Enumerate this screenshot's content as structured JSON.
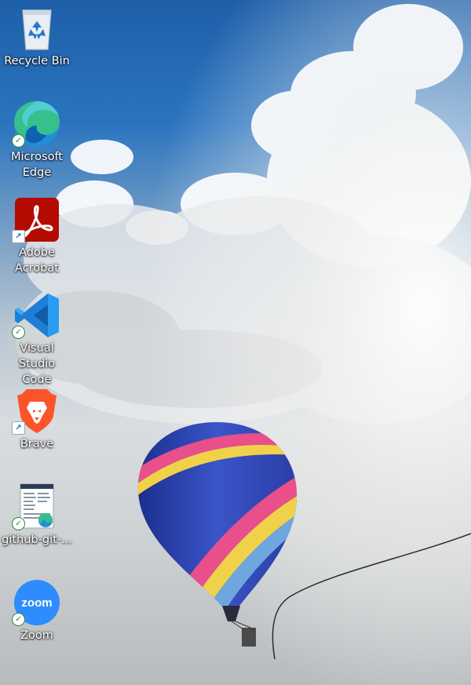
{
  "desktop": {
    "icons": [
      {
        "label": "Recycle Bin",
        "icon": "recycle-bin-icon",
        "badge": ""
      },
      {
        "label": "Microsoft\nEdge",
        "icon": "edge-icon",
        "badge": "sync"
      },
      {
        "label": "Adobe\nAcrobat",
        "icon": "acrobat-icon",
        "badge": "shortcut"
      },
      {
        "label": "Visual Studio\nCode",
        "icon": "vscode-icon",
        "badge": "sync"
      },
      {
        "label": "Brave",
        "icon": "brave-icon",
        "badge": "shortcut"
      },
      {
        "label": "github-git-...",
        "icon": "pdf-document-icon",
        "badge": "sync"
      },
      {
        "label": "Zoom",
        "icon": "zoom-icon",
        "badge": "sync"
      }
    ],
    "zoom_logo_text": "zoom"
  },
  "colors": {
    "edge": "#1f8fd6",
    "acrobat": "#b30b00",
    "vscode": "#2a8fe0",
    "brave": "#fb542b",
    "zoom": "#2d8cff",
    "sync_badge": "#1a8a2a"
  }
}
